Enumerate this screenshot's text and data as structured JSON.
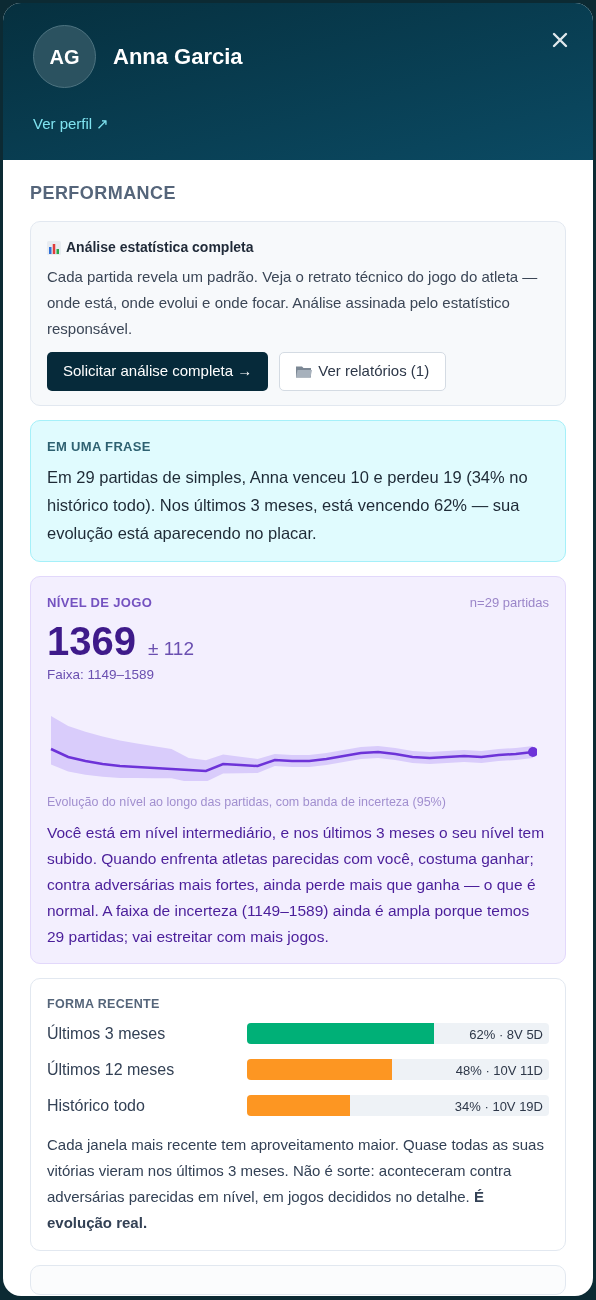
{
  "header": {
    "initials": "AG",
    "name": "Anna Garcia",
    "profile_link": "Ver perfil ↗"
  },
  "section_title": "PERFORMANCE",
  "analysis": {
    "title": "Análise estatística completa",
    "text": "Cada partida revela um padrão. Veja o retrato técnico do jogo do atleta — onde está, onde evolui e onde focar. Análise assinada pelo estatístico responsável.",
    "primary_button": "Solicitar análise completa →",
    "secondary_button": "Ver relatórios (1)"
  },
  "summary": {
    "label": "EM UMA FRASE",
    "text": "Em 29 partidas de simples, Anna venceu 10 e perdeu 19 (34% no histórico todo). Nos últimos 3 meses, está vencendo 62% — sua evolução está aparecendo no placar."
  },
  "level": {
    "label": "NÍVEL DE JOGO",
    "sample": "n=29 partidas",
    "rating": "1369",
    "margin": "± 112",
    "range": "Faixa: 1149–1589",
    "chart_caption": "Evolução do nível ao longo das partidas, com banda de incerteza (95%)",
    "text": "Você está em nível intermediário, e nos últimos 3 meses o seu nível tem subido. Quando enfrenta atletas parecidas com você, costuma ganhar; contra adversárias mais fortes, ainda perde mais que ganha — o que é normal. A faixa de incerteza (1149–1589) ainda é ampla porque temos 29 partidas; vai estreitar com mais jogos."
  },
  "form": {
    "label": "FORMA RECENTE",
    "rows": [
      {
        "name": "Últimos 3 meses",
        "level": 0.62,
        "color": "#00b077",
        "reading": "62% · 8V 5D"
      },
      {
        "name": "Últimos 12 meses",
        "level": 0.48,
        "color": "#fd9622",
        "reading": "48% · 10V 11D"
      },
      {
        "name": "Histórico todo",
        "level": 0.34,
        "color": "#fd9622",
        "reading": "34% · 10V 19D"
      }
    ],
    "text": "Cada janela mais recente tem aproveitamento maior. Quase todas as suas vitórias vieram nos últimos 3 meses. Não é sorte: aconteceram contra adversárias parecidas em nível, em jogos decididos no detalhe. **É evolução real.**"
  }
}
